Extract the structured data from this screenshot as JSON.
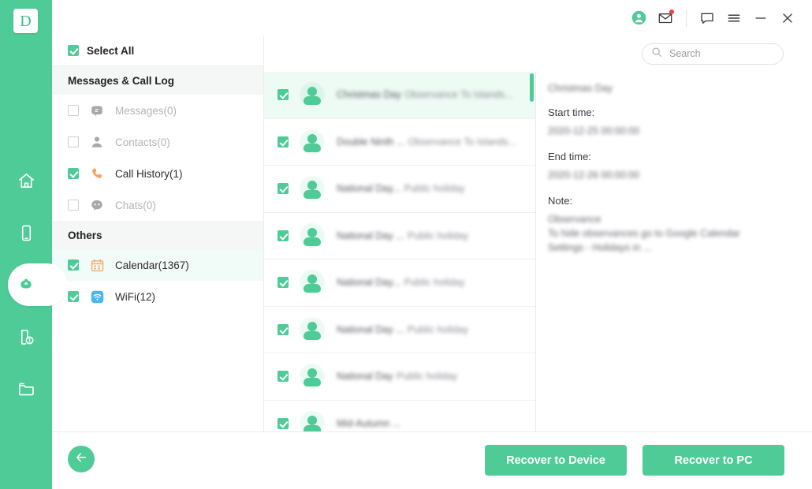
{
  "brand": {
    "logo_letter": "D",
    "accent": "#4ecb96",
    "accent_soft": "#eefaf4",
    "badge_color": "#f3403f"
  },
  "titlebar": {
    "icons": [
      {
        "name": "account-icon",
        "label": "Account"
      },
      {
        "name": "mail-icon",
        "label": "Messages",
        "badge": true
      },
      {
        "name": "feedback-icon",
        "label": "Feedback"
      },
      {
        "name": "menu-icon",
        "label": "Menu"
      },
      {
        "name": "minimize-icon",
        "label": "Minimize"
      },
      {
        "name": "close-icon",
        "label": "Close"
      }
    ]
  },
  "rail": {
    "items": [
      {
        "name": "home",
        "label": "Home",
        "active": false
      },
      {
        "name": "device",
        "label": "Device",
        "active": false
      },
      {
        "name": "recover",
        "label": "Recover",
        "active": true
      },
      {
        "name": "repair",
        "label": "Repair",
        "active": false
      },
      {
        "name": "files",
        "label": "Files",
        "active": false
      }
    ]
  },
  "categories": {
    "select_all_label": "Select All",
    "select_all_checked": true,
    "groups": [
      {
        "title": "Messages & Call Log",
        "items": [
          {
            "label": "Messages(0)",
            "icon": "messages-icon",
            "checked": false,
            "enabled": false,
            "selected": false
          },
          {
            "label": "Contacts(0)",
            "icon": "contacts-icon",
            "checked": false,
            "enabled": false,
            "selected": false
          },
          {
            "label": "Call History(1)",
            "icon": "call-history-icon",
            "checked": true,
            "enabled": true,
            "selected": false
          },
          {
            "label": "Chats(0)",
            "icon": "chats-icon",
            "checked": false,
            "enabled": false,
            "selected": false
          }
        ]
      },
      {
        "title": "Others",
        "items": [
          {
            "label": "Calendar(1367)",
            "icon": "calendar-icon",
            "checked": true,
            "enabled": true,
            "selected": true
          },
          {
            "label": "WiFi(12)",
            "icon": "wifi-icon",
            "checked": true,
            "enabled": true,
            "selected": false
          }
        ]
      }
    ]
  },
  "search": {
    "placeholder": "Search",
    "value": "",
    "icon": "search-icon"
  },
  "list": {
    "scroll_position": "top",
    "items": [
      {
        "title": "Christmas Day",
        "subtitle": "Observance To Islands...",
        "checked": true,
        "selected": true
      },
      {
        "title": "Double Ninth ...",
        "subtitle": "Observance To Islands...",
        "checked": true,
        "selected": false
      },
      {
        "title": "National Day...",
        "subtitle": "Public holiday",
        "checked": true,
        "selected": false
      },
      {
        "title": "National Day ...",
        "subtitle": "Public holiday",
        "checked": true,
        "selected": false
      },
      {
        "title": "National Day...",
        "subtitle": "Public holiday",
        "checked": true,
        "selected": false
      },
      {
        "title": "National Day ...",
        "subtitle": "Public holiday",
        "checked": true,
        "selected": false
      },
      {
        "title": "National Day",
        "subtitle": "Public holiday",
        "checked": true,
        "selected": false
      },
      {
        "title": "Mid-Autumn ...",
        "subtitle": "",
        "checked": true,
        "selected": false
      }
    ]
  },
  "detail": {
    "title": "Christmas Day",
    "start_time_label": "Start time:",
    "start_time_value": "2020-12-25 00:00:00",
    "end_time_label": "End time:",
    "end_time_value": "2020-12-26 00:00:00",
    "note_label": "Note:",
    "note_lines": [
      "Observance",
      "To hide observances go to Google Calendar",
      "Settings - Holidays in ..."
    ]
  },
  "footer": {
    "back_label": "Back",
    "back_icon": "arrow-left-icon",
    "recover_to_device_label": "Recover to Device",
    "recover_to_pc_label": "Recover to PC"
  }
}
